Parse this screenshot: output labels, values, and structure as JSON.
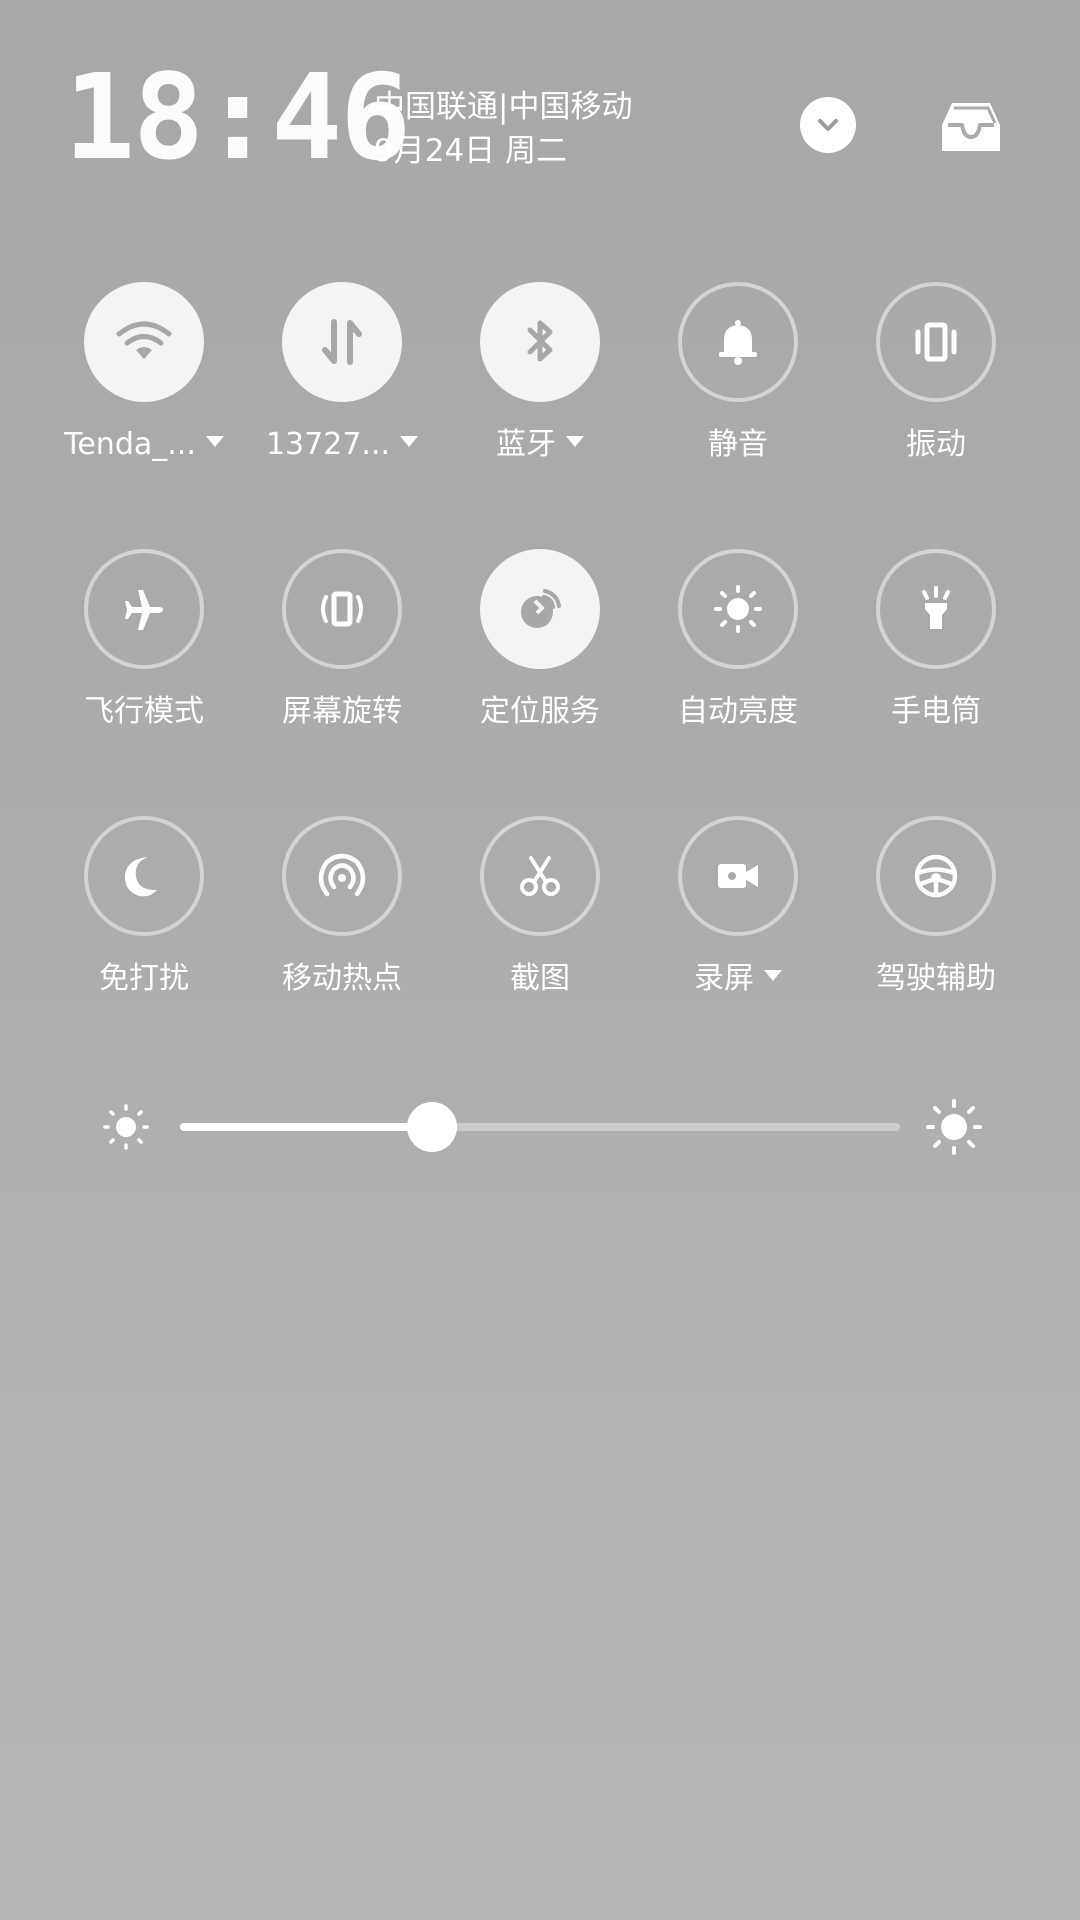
{
  "header": {
    "time": "18:46",
    "carrier": "中国联通|中国移动",
    "date": "9月24日 周二",
    "collapse_icon": "chevron-down-icon",
    "inbox_icon": "inbox-icon"
  },
  "toggles": [
    {
      "label": "Tenda_...",
      "icon": "wifi-icon",
      "on": true,
      "dropdown": true
    },
    {
      "label": "13727...",
      "icon": "mobile-data-icon",
      "on": true,
      "dropdown": true
    },
    {
      "label": "蓝牙",
      "icon": "bluetooth-icon",
      "on": true,
      "dropdown": true
    },
    {
      "label": "静音",
      "icon": "bell-icon",
      "on": false,
      "dropdown": false
    },
    {
      "label": "振动",
      "icon": "vibrate-icon",
      "on": false,
      "dropdown": false
    },
    {
      "label": "飞行模式",
      "icon": "airplane-icon",
      "on": false,
      "dropdown": false
    },
    {
      "label": "屏幕旋转",
      "icon": "rotate-icon",
      "on": false,
      "dropdown": false
    },
    {
      "label": "定位服务",
      "icon": "location-icon",
      "on": true,
      "dropdown": false
    },
    {
      "label": "自动亮度",
      "icon": "auto-brightness-icon",
      "on": false,
      "dropdown": false
    },
    {
      "label": "手电筒",
      "icon": "flashlight-icon",
      "on": false,
      "dropdown": false
    },
    {
      "label": "免打扰",
      "icon": "moon-icon",
      "on": false,
      "dropdown": false
    },
    {
      "label": "移动热点",
      "icon": "hotspot-icon",
      "on": false,
      "dropdown": false
    },
    {
      "label": "截图",
      "icon": "scissors-icon",
      "on": false,
      "dropdown": false
    },
    {
      "label": "录屏",
      "icon": "video-camera-icon",
      "on": false,
      "dropdown": true
    },
    {
      "label": "驾驶辅助",
      "icon": "steering-wheel-icon",
      "on": false,
      "dropdown": false
    }
  ],
  "brightness": {
    "level": 0.35,
    "low_icon": "brightness-low-icon",
    "high_icon": "brightness-high-icon"
  },
  "colors": {
    "background": "#ababab",
    "tile_on": "#f4f4f4",
    "tile_off_border": "#d4d4d4",
    "icon_on": "#a7a7a7",
    "icon_off": "#ffffff"
  }
}
